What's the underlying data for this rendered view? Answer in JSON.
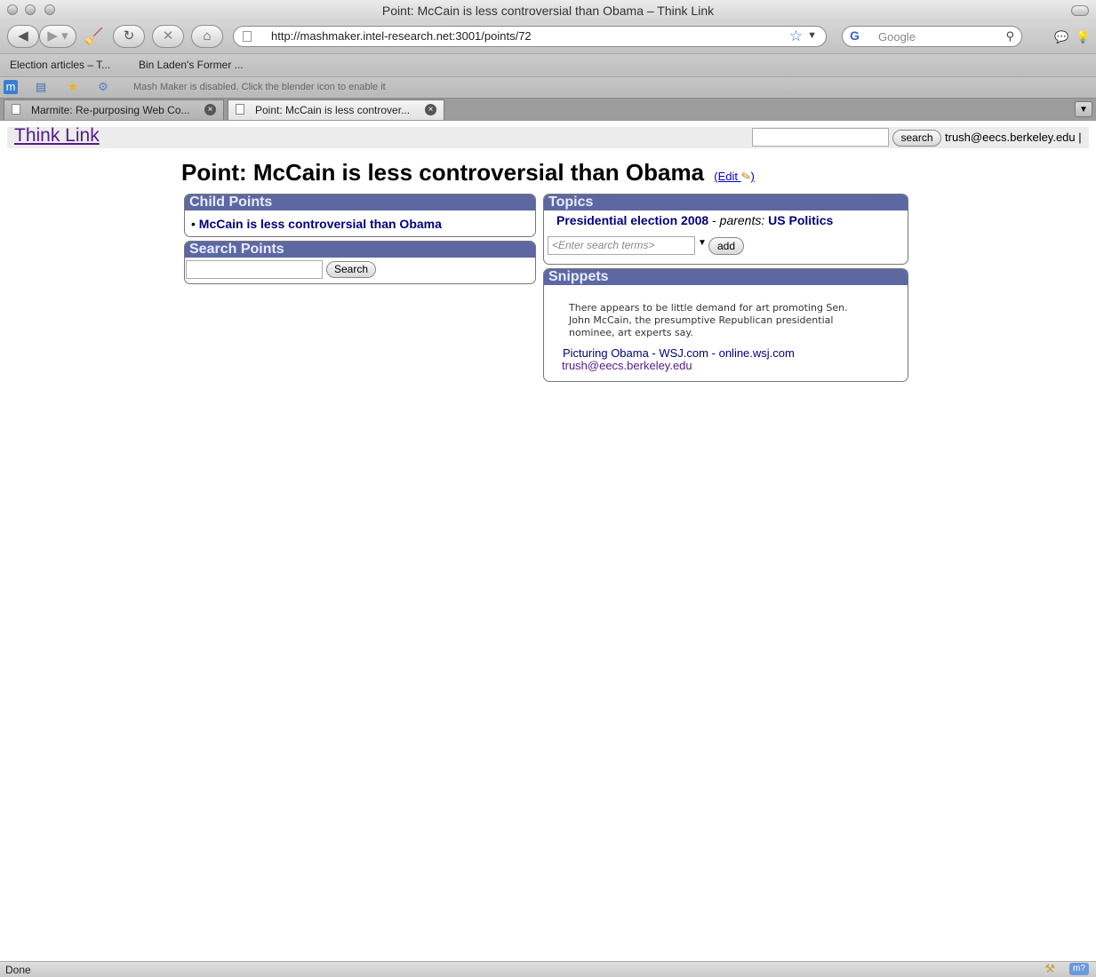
{
  "window": {
    "title": "Point: McCain is less controversial than Obama – Think Link"
  },
  "toolbar": {
    "url": "http://mashmaker.intel-research.net:3001/points/72",
    "search_placeholder": "Google"
  },
  "bookmarks": [
    {
      "label": "Election articles – T..."
    },
    {
      "label": "Bin Laden's Former ..."
    }
  ],
  "addon_bar": {
    "message": "Mash Maker is disabled. Click the blender icon to enable it"
  },
  "tabs": [
    {
      "label": "Marmite: Re-purposing Web Co..."
    },
    {
      "label": "Point: McCain is less controver..."
    }
  ],
  "header": {
    "site_title": "Think Link",
    "search_button": "search",
    "user_email": "trush@eecs.berkeley.edu",
    "user_separator": "|"
  },
  "page": {
    "title": "Point: McCain is less controversial than Obama",
    "edit_label": "(Edit",
    "edit_close": ")"
  },
  "child_points": {
    "heading": "Child Points",
    "items": [
      {
        "label": "McCain is less controversial than Obama"
      }
    ]
  },
  "search_points": {
    "heading": "Search Points",
    "button": "Search"
  },
  "topics": {
    "heading": "Topics",
    "topic": "Presidential election 2008",
    "parents_label": "parents:",
    "parent": "US Politics",
    "input_placeholder": "<Enter search terms>",
    "add_button": "add"
  },
  "snippets": {
    "heading": "Snippets",
    "text": "There appears to be little demand for art promoting Sen. John McCain, the presumptive Republican presidential nominee, art experts say.",
    "source_title": "Picturing Obama - WSJ.com",
    "source_separator": "-",
    "source_domain": "online.wsj.com",
    "author": "trush@eecs.berkeley.edu"
  },
  "status": {
    "text": "Done"
  },
  "colors": {
    "box_header": "#5d68a3",
    "link_blue": "#000080",
    "visited_purple": "#551a8b"
  }
}
